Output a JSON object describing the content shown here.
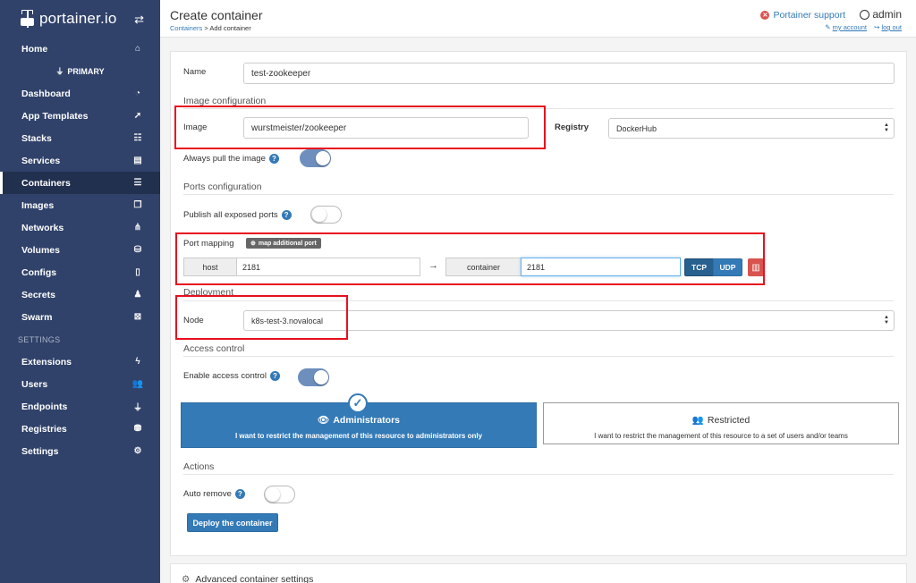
{
  "app": {
    "logo_text": "portainer.io",
    "switch_icon": "exchange-icon"
  },
  "sidebar": {
    "home": {
      "label": "Home",
      "icon": "home-icon"
    },
    "environment": "PRIMARY",
    "items": [
      {
        "label": "Dashboard",
        "icon": "tachometer-icon",
        "glyph": "◔"
      },
      {
        "label": "App Templates",
        "icon": "rocket-icon",
        "glyph": "➚"
      },
      {
        "label": "Stacks",
        "icon": "th-list-icon",
        "glyph": "☷"
      },
      {
        "label": "Services",
        "icon": "list-alt-icon",
        "glyph": "▤"
      },
      {
        "label": "Containers",
        "icon": "server-icon",
        "glyph": "☰",
        "active": true
      },
      {
        "label": "Images",
        "icon": "clone-icon",
        "glyph": "❐"
      },
      {
        "label": "Networks",
        "icon": "sitemap-icon",
        "glyph": "⋔"
      },
      {
        "label": "Volumes",
        "icon": "cubes-icon",
        "glyph": "⛁"
      },
      {
        "label": "Configs",
        "icon": "file-code-icon",
        "glyph": "▯"
      },
      {
        "label": "Secrets",
        "icon": "user-secret-icon",
        "glyph": "♟"
      },
      {
        "label": "Swarm",
        "icon": "object-group-icon",
        "glyph": "⊠"
      }
    ],
    "settings_heading": "SETTINGS",
    "settings_items": [
      {
        "label": "Extensions",
        "icon": "bolt-icon",
        "glyph": "ϟ"
      },
      {
        "label": "Users",
        "icon": "users-icon",
        "glyph": "👥"
      },
      {
        "label": "Endpoints",
        "icon": "plug-icon",
        "glyph": "⏚"
      },
      {
        "label": "Registries",
        "icon": "database-icon",
        "glyph": "⛃"
      },
      {
        "label": "Settings",
        "icon": "cogs-icon",
        "glyph": "⚙"
      }
    ]
  },
  "header": {
    "title": "Create container",
    "breadcrumb_link": "Containers",
    "breadcrumb_rest": " > Add container",
    "support_label": "Portainer support",
    "username": "admin",
    "my_account": "my account",
    "log_out": "log out"
  },
  "form": {
    "name_label": "Name",
    "name_value": "test-zookeeper",
    "image_section": "Image configuration",
    "image_label": "Image",
    "image_value": "wurstmeister/zookeeper",
    "registry_label": "Registry",
    "registry_value": "DockerHub",
    "always_pull_label": "Always pull the image",
    "always_pull_on": true,
    "ports_section": "Ports configuration",
    "publish_all_label": "Publish all exposed ports",
    "publish_all_on": false,
    "port_mapping_label": "Port mapping",
    "map_port_button": "map additional port",
    "host_addon": "host",
    "host_port": "2181",
    "container_addon": "container",
    "container_port": "2181",
    "tcp_label": "TCP",
    "udp_label": "UDP",
    "deployment_section": "Deployment",
    "node_label": "Node",
    "node_value": "k8s-test-3.novalocal",
    "access_section": "Access control",
    "enable_access_label": "Enable access control",
    "enable_access_on": true,
    "admin_title": "Administrators",
    "admin_desc": "I want to restrict the management of this resource to administrators only",
    "restricted_title": "Restricted",
    "restricted_desc": "I want to restrict the management of this resource to a set of users and/or teams",
    "actions_section": "Actions",
    "auto_remove_label": "Auto remove",
    "auto_remove_on": false,
    "deploy_button": "Deploy the container"
  },
  "advanced": {
    "label": "Advanced container settings"
  },
  "colors": {
    "sidebar_bg": "#30426a",
    "primary": "#337ab7",
    "danger": "#d9534f",
    "highlight_box": "#e8101f"
  }
}
